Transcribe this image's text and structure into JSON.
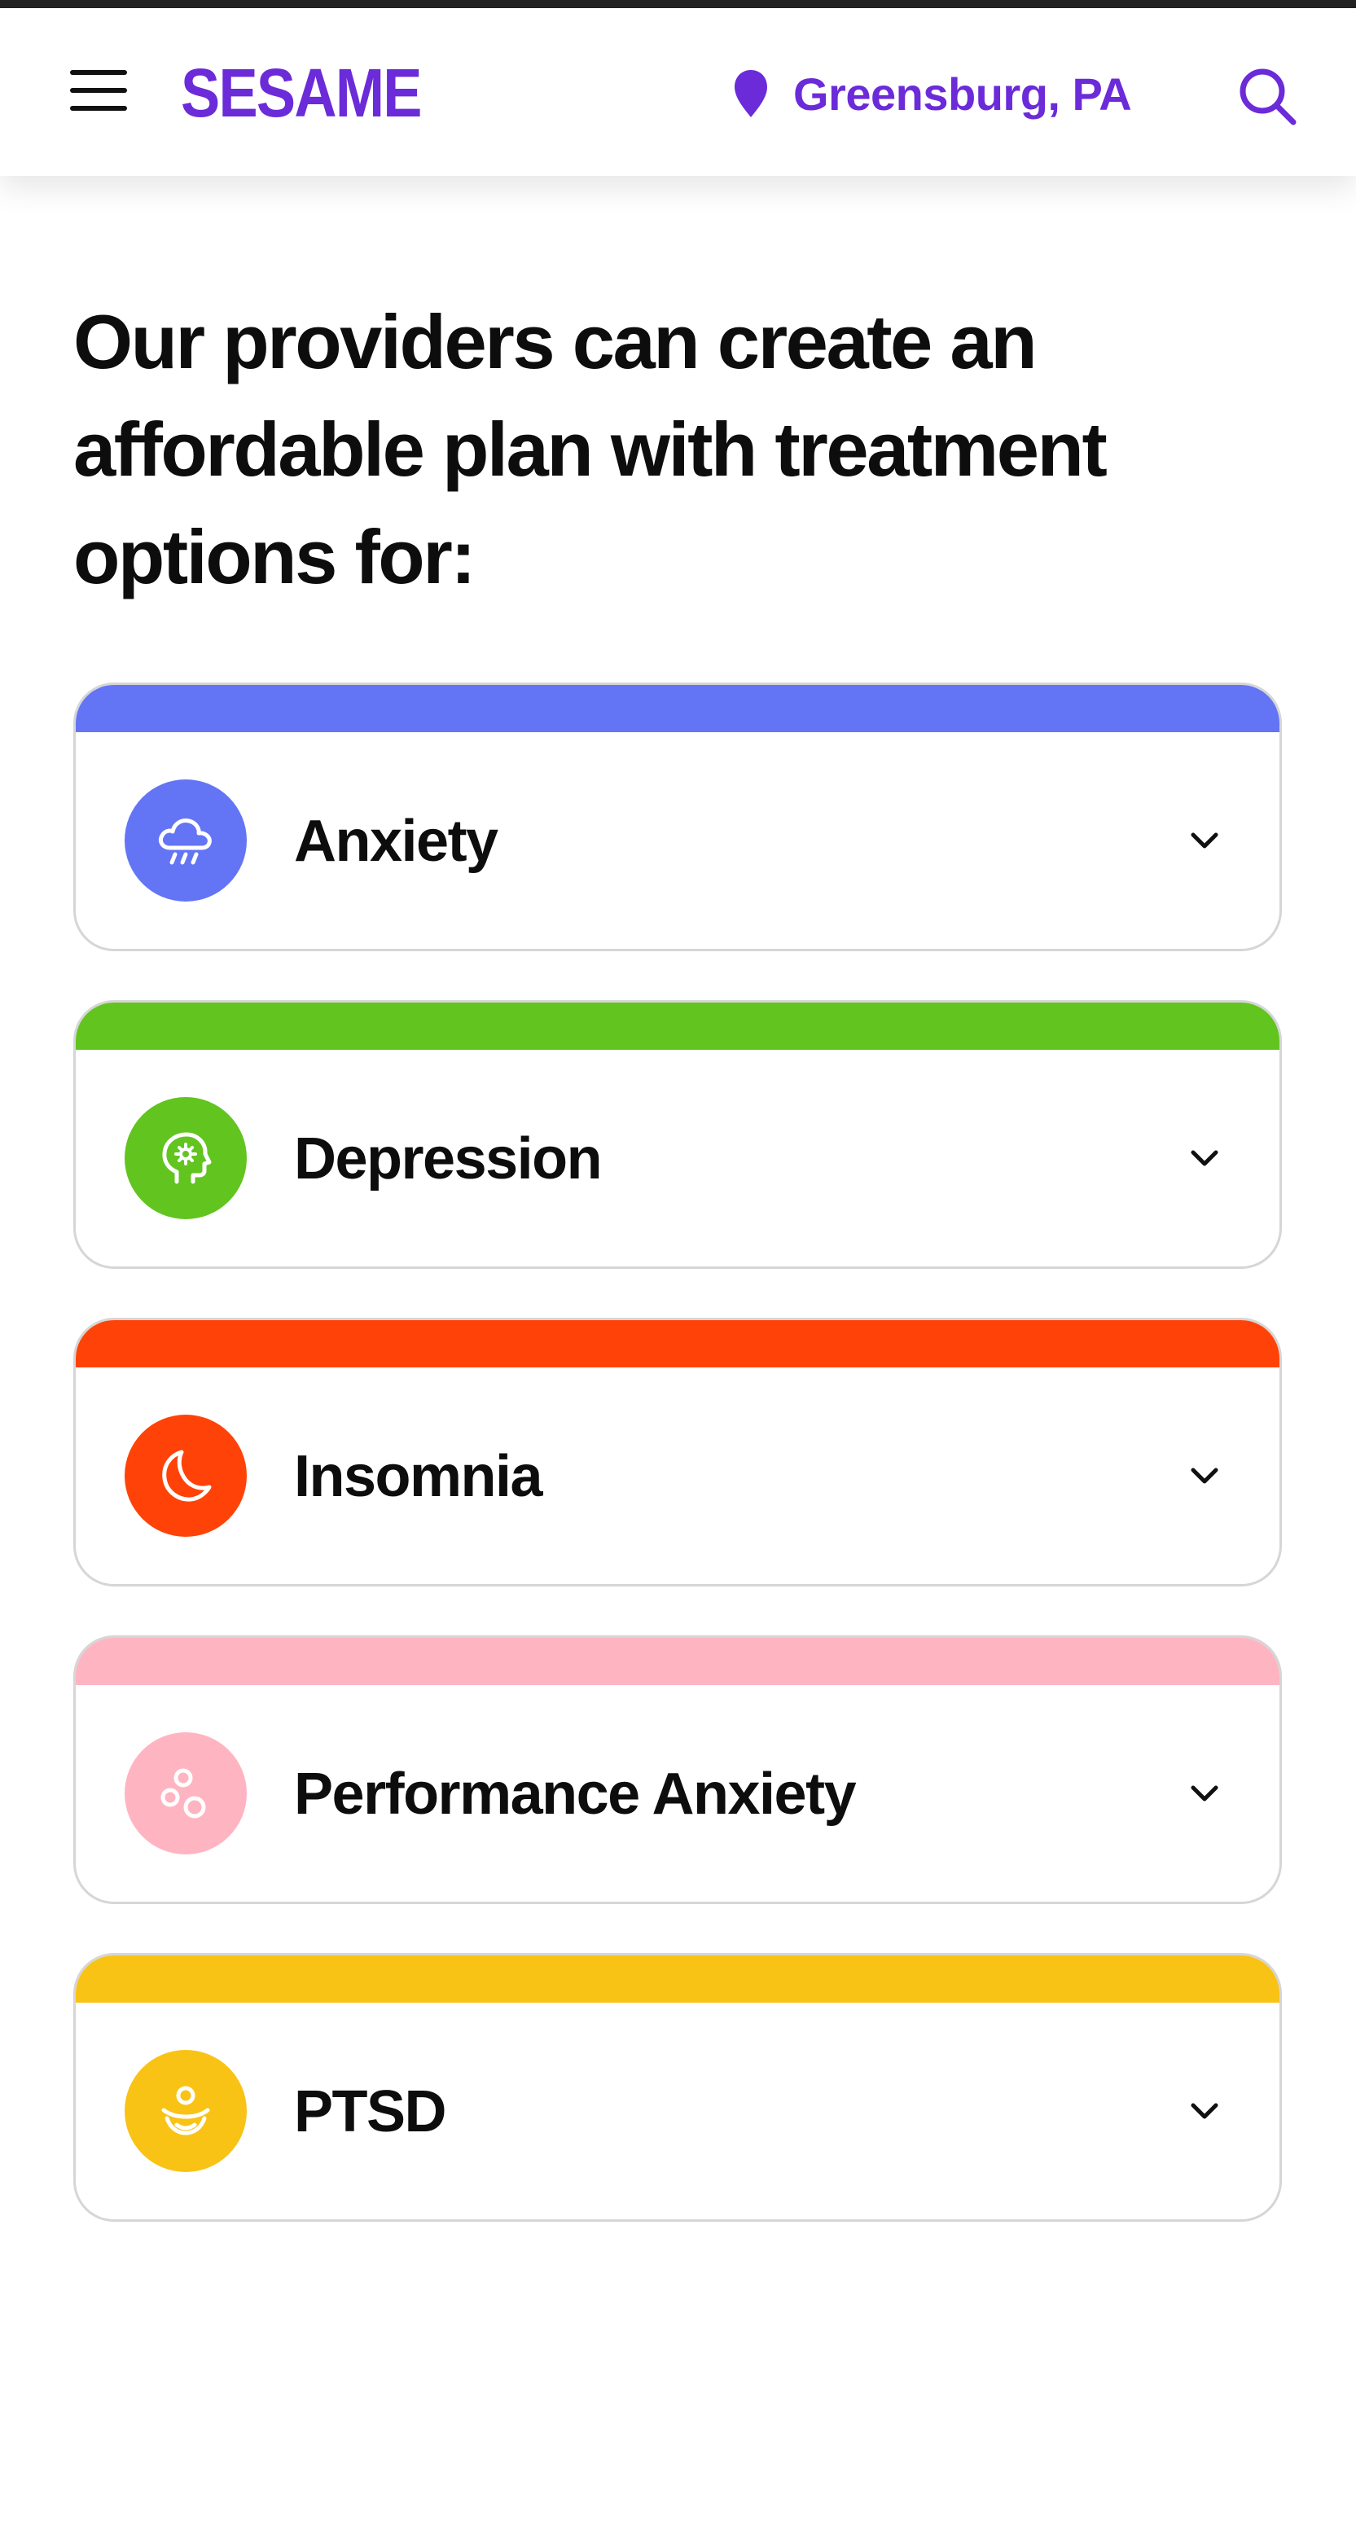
{
  "header": {
    "logo": "SESAME",
    "location": "Greensburg, PA",
    "brand_color": "#6b2bd9"
  },
  "headline": "Our providers can create an affordable plan with treatment options for:",
  "conditions": [
    {
      "label": "Anxiety",
      "color": "#6375f5",
      "icon": "rain-cloud-icon"
    },
    {
      "label": "Depression",
      "color": "#62c41e",
      "icon": "head-gear-icon"
    },
    {
      "label": "Insomnia",
      "color": "#ff4308",
      "icon": "moon-icon"
    },
    {
      "label": "Performance Anxiety",
      "color": "#ffb4c2",
      "icon": "bubbles-icon"
    },
    {
      "label": "PTSD",
      "color": "#f9c315",
      "icon": "meditation-icon"
    }
  ]
}
